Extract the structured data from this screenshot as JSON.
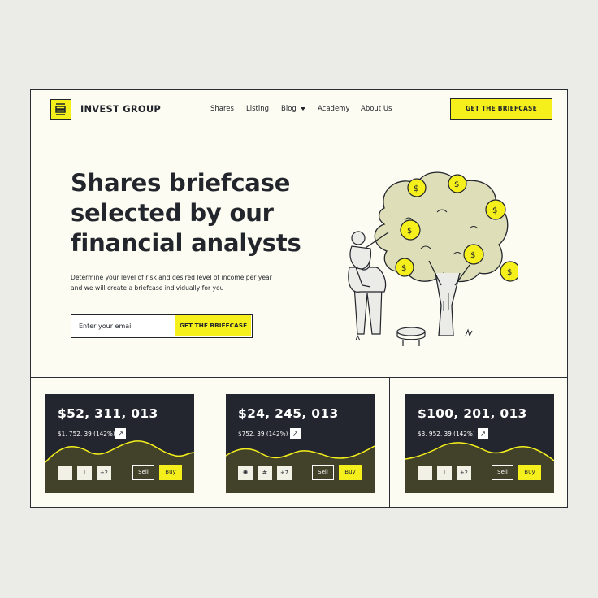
{
  "brand": {
    "name": "INVEST GROUP"
  },
  "nav": {
    "items": [
      "Shares",
      "Listing",
      "Blog",
      "Academy",
      "About Us"
    ],
    "cta": "GET THE BRIEFCASE"
  },
  "hero": {
    "title_lines": [
      "Shares briefcase",
      "selected by our",
      "financial analysts"
    ],
    "subtitle_lines": [
      "Determine your level of risk and desired level of income per year",
      "and we will create a briefcase individually for you"
    ],
    "email_placeholder": "Enter your email",
    "cta": "GET THE BRIEFCASE"
  },
  "cards": [
    {
      "amount": "$52, 311, 013",
      "delta": "$1, 752, 39 (142%)",
      "chips": [
        "apple",
        "tesla",
        "+2"
      ],
      "sell": "Sell",
      "buy": "Buy"
    },
    {
      "amount": "$24, 245, 013",
      "delta": "$752, 39 (142%)",
      "chips": [
        "openai",
        "slack",
        "+7"
      ],
      "sell": "Sell",
      "buy": "Buy"
    },
    {
      "amount": "$100, 201, 013",
      "delta": "$3, 952, 39 (142%)",
      "chips": [
        "apple",
        "tesla",
        "+2"
      ],
      "sell": "Sell",
      "buy": "Buy"
    }
  ],
  "colors": {
    "accent": "#f5f01c",
    "dark": "#23262f",
    "canvas": "#fcfcf2",
    "page": "#ebebe7"
  },
  "icons": [
    "logo-icon",
    "chevron-down-icon",
    "arrow-up-right-icon",
    "apple-icon",
    "tesla-icon",
    "openai-icon",
    "slack-icon",
    "dollar-coin-icon"
  ]
}
